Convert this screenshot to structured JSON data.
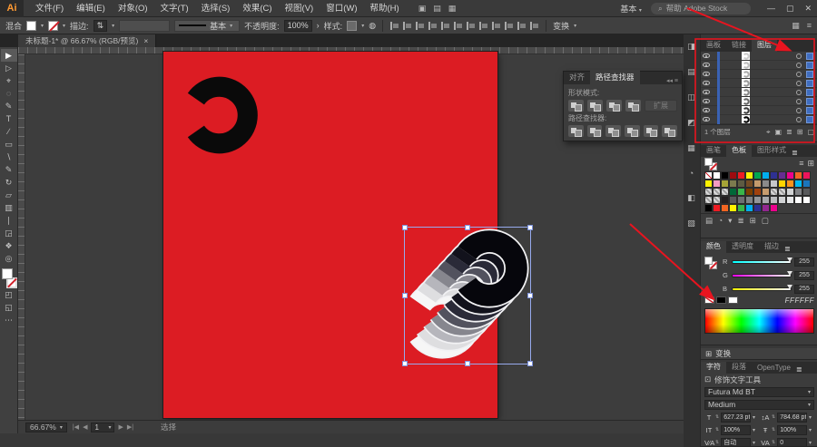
{
  "menu_bar": {
    "logo": "Ai",
    "items": [
      "文件(F)",
      "编辑(E)",
      "对象(O)",
      "文字(T)",
      "选择(S)",
      "效果(C)",
      "视图(V)",
      "窗口(W)",
      "帮助(H)"
    ],
    "icons": [
      "▣",
      "▤",
      "▦"
    ],
    "workspace": "基本",
    "workspace_caret": "▾",
    "search_icon": "⌕",
    "search_text": "帮助 Adobe Stock",
    "window_controls": {
      "minimize": "—",
      "maximize": "▢",
      "close": "✕"
    }
  },
  "control_bar": {
    "context_label": "混合",
    "stroke_label": "描边:",
    "stroke_profile": "基本",
    "opacity_label": "不透明度:",
    "opacity_value": "100%",
    "opacity_more": "›",
    "style_label": "样式:",
    "recolor_icon": "◍",
    "align_icons": [
      "align-left",
      "align-h-center",
      "align-right",
      "align-top",
      "align-v-center",
      "align-bottom",
      "distribute-1",
      "distribute-2",
      "distribute-3",
      "distribute-4",
      "distribute-5",
      "distribute-6"
    ],
    "transform_label": "变换",
    "right_icons": [
      "▦",
      "≡"
    ]
  },
  "document_tab": {
    "title": "未标题-1* @ 66.67% (RGB/预览)",
    "close": "×"
  },
  "toolbar": {
    "tools": [
      {
        "name": "selection-tool",
        "glyph": "▶",
        "active": true
      },
      {
        "name": "direct-selection-tool",
        "glyph": "▷",
        "active": false
      },
      {
        "name": "magic-wand-tool",
        "glyph": "⌖",
        "active": false
      },
      {
        "name": "lasso-tool",
        "glyph": "◌",
        "active": false
      },
      {
        "name": "pen-tool",
        "glyph": "✎",
        "active": false
      },
      {
        "name": "type-tool",
        "glyph": "T",
        "active": false
      },
      {
        "name": "line-segment-tool",
        "glyph": "∕",
        "active": false
      },
      {
        "name": "rectangle-tool",
        "glyph": "▭",
        "active": false
      },
      {
        "name": "paintbrush-tool",
        "glyph": "∖",
        "active": false
      },
      {
        "name": "pencil-tool",
        "glyph": "✎",
        "active": false
      },
      {
        "name": "rotate-tool",
        "glyph": "↻",
        "active": false
      },
      {
        "name": "scale-tool",
        "glyph": "▱",
        "active": false
      },
      {
        "name": "gradient-tool",
        "glyph": "▥",
        "active": false
      },
      {
        "name": "eyedropper-tool",
        "glyph": "∣",
        "active": false
      },
      {
        "name": "blend-tool",
        "glyph": "◲",
        "active": false
      },
      {
        "name": "hand-tool",
        "glyph": "❖",
        "active": false
      },
      {
        "name": "zoom-tool",
        "glyph": "◎",
        "active": false
      }
    ],
    "bottom_icons": [
      "◰",
      "◱",
      "⋯"
    ]
  },
  "artwork": {
    "artboard_color": "#dc1c23",
    "glyph_color": "#0a0a0a",
    "selection_color": "#97aaed",
    "blend_colors": [
      "#06060c",
      "#12121c",
      "#2a2a38",
      "#52525e",
      "#86868e",
      "#b6b6bc",
      "#dedee0",
      "#f6f6f6"
    ],
    "blend_outline": "#f2f2f4"
  },
  "pathfinder_panel": {
    "tabs": [
      {
        "label": "对齐",
        "active": false
      },
      {
        "label": "路径查找器",
        "active": true
      }
    ],
    "header_icons": "◂◂ ≡",
    "shape_modes_label": "形状模式:",
    "shape_mode_buttons": [
      "unite",
      "minus-front",
      "intersect",
      "exclude"
    ],
    "expand_button": "扩展",
    "pathfinders_label": "路径查找器:",
    "pathfinder_buttons": [
      "divide",
      "trim",
      "merge",
      "crop",
      "outline",
      "minus-back"
    ]
  },
  "dock": {
    "collapsed_icons": [
      "◨",
      "▤",
      "◫",
      "◩",
      "▦",
      "◔",
      "◧",
      "▧"
    ]
  },
  "layers_panel": {
    "tabs": [
      {
        "label": "画板",
        "active": false
      },
      {
        "label": "链接",
        "active": false
      },
      {
        "label": "图层",
        "active": true
      }
    ],
    "menu_icon": "≣",
    "rows": 8,
    "thumb_colors": [
      "#c9c9c9",
      "#bdbdbd",
      "#ababab",
      "#989898",
      "#848484",
      "#666666",
      "#3a3a3a",
      "#000000"
    ],
    "footer_text": "1 个图层",
    "footer_icons": [
      "⌖",
      "▣",
      "≣",
      "⊞",
      "▢"
    ]
  },
  "swatches_panel": {
    "tabs": [
      {
        "label": "画笔",
        "active": false
      },
      {
        "label": "色板",
        "active": true
      },
      {
        "label": "图形样式",
        "active": false
      }
    ],
    "view_icons": [
      "≡",
      "⊞"
    ],
    "grid": [
      [
        "slash",
        "#ffffff",
        "#000000",
        "#9e0b0f",
        "#ed1c24",
        "#fff200",
        "#00a651",
        "#00aeef",
        "#2e3192",
        "#662d91",
        "#ec008c",
        "#f26522",
        "#ed145b"
      ],
      [
        "#fff200",
        "#f49ac1",
        "#a6a437",
        "#7c7b4e",
        "#5e5b42",
        "#754c24",
        "#c49a6c",
        "#8a8a8a",
        "#c7c8ca",
        "#ffd400",
        "#f7941d",
        "#00b9f2",
        "#1b75bc"
      ],
      [
        "pat",
        "pat",
        "pat",
        "#006838",
        "#39b54a",
        "#7b3f00",
        "#a0410d",
        "#c69c6e",
        "pat",
        "pat",
        "#d1d3d4",
        "#808285",
        "#58595b"
      ],
      [
        "pat",
        "pat",
        "#231f20",
        "#58595b",
        "#6d6e71",
        "#808285",
        "#939598",
        "#a7a9ac",
        "#bcbec0",
        "#d1d3d4",
        "#e6e7e8",
        "#ffffff",
        "#ffffff"
      ],
      [
        "#000000",
        "#ed1c24",
        "#f26522",
        "#fff200",
        "#39b54a",
        "#00aeef",
        "#2e3192",
        "#92278f",
        "#ec008c",
        "empty",
        "empty",
        "empty",
        "empty"
      ]
    ],
    "footer_icons": [
      "▤",
      "◔",
      "▾",
      "≣",
      "⊞",
      "▢"
    ]
  },
  "color_panel": {
    "tabs": [
      {
        "label": "颜色",
        "active": true
      },
      {
        "label": "透明度",
        "active": false
      },
      {
        "label": "描边",
        "active": false
      }
    ],
    "sliders": [
      {
        "label": "R",
        "value": "255",
        "gradient_from": "#00ffff",
        "gradient_to": "#ffffff"
      },
      {
        "label": "G",
        "value": "255",
        "gradient_from": "#ff00ff",
        "gradient_to": "#ffffff"
      },
      {
        "label": "B",
        "value": "255",
        "gradient_from": "#ffff00",
        "gradient_to": "#ffffff"
      }
    ],
    "hex_value": "FFFFFF",
    "chips": [
      "slash",
      "#000000",
      "#ffffff"
    ]
  },
  "transform_bar": {
    "icon": "⊞",
    "label": "变换"
  },
  "character_panel": {
    "tabs": [
      {
        "label": "字符",
        "active": true
      },
      {
        "label": "段落",
        "active": false
      },
      {
        "label": "OpenType",
        "active": false
      }
    ],
    "menu_icon": "≣",
    "touch_tool_icon": "⊡",
    "touch_tool_label": "修饰文字工具",
    "font_name": "Futura Md BT",
    "font_style": "Medium",
    "fields": [
      {
        "name": "font-size",
        "icon": "T",
        "value": "627.23 pt"
      },
      {
        "name": "leading",
        "icon": "↕A",
        "value": "784.68 pt"
      },
      {
        "name": "vertical-scale",
        "icon": "IT",
        "value": "100%"
      },
      {
        "name": "horizontal-scale",
        "icon": "Ŧ",
        "value": "100%"
      },
      {
        "name": "kerning",
        "icon": "V⁄A",
        "value": "自动"
      },
      {
        "name": "tracking",
        "icon": "VA",
        "value": "0"
      }
    ]
  },
  "status_bar": {
    "zoom": "66.67%",
    "nav_first": "|◀",
    "nav_prev": "◀",
    "artboard_number": "1",
    "nav_next": "▶",
    "nav_last": "▶|",
    "status_text": "选择"
  },
  "annotations": {
    "color": "#e8141f"
  }
}
